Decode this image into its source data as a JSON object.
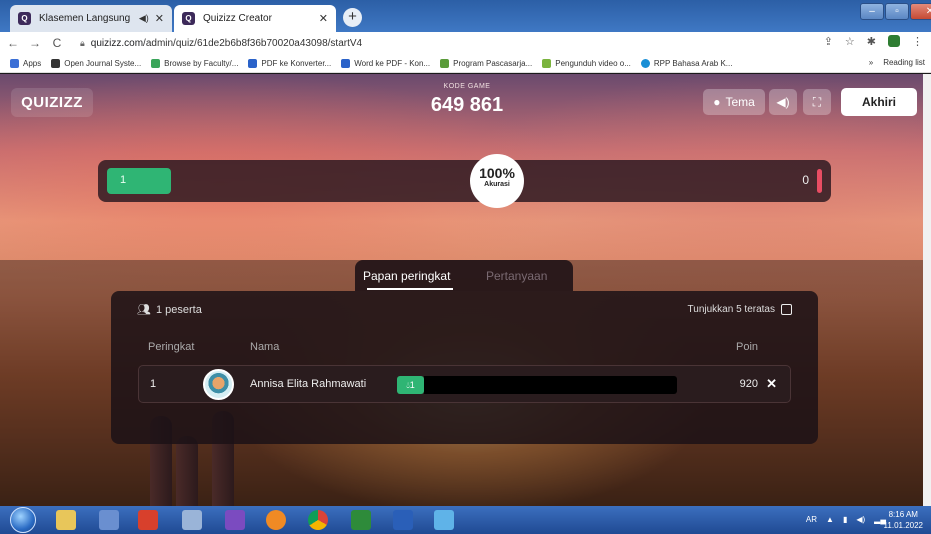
{
  "browser": {
    "tabs": [
      {
        "title": "Klasemen Langsung",
        "audio_icon": "speaker-icon"
      },
      {
        "title": "Quizizz Creator"
      }
    ],
    "url_host": "quizizz.com",
    "url_path": "/admin/quiz/61de2b6b8f36b70020a43098/startV4",
    "bookmarks": [
      "Apps",
      "Open Journal Syste...",
      "Browse by Faculty/...",
      "PDF ke Konverter...",
      "Word ke PDF - Kon...",
      "Program Pascasarja...",
      "Pengunduh video o...",
      "RPP Bahasa Arab K..."
    ],
    "bookmark_chevron": "»",
    "reading_list": "Reading list"
  },
  "quiz": {
    "logo": "QUIZIZZ",
    "code_caption": "KODE GAME",
    "code": "649 861",
    "tema_label": "Tema",
    "end_label": "Akhiri",
    "accuracy": {
      "correct": "1",
      "incorrect": "0",
      "percent": "100%",
      "label": "Akurasi"
    },
    "tabs": [
      "Papan peringkat",
      "Pertanyaan"
    ],
    "participants": "1 peserta",
    "top5_label": "Tunjukkan 5 teratas",
    "columns": {
      "rank": "Peringkat",
      "name": "Nama",
      "points": "Poin"
    },
    "rows": [
      {
        "rank": "1",
        "name": "Annisa Elita Rahmawati",
        "correct": "1",
        "points": "920"
      }
    ]
  },
  "taskbar": {
    "lang": "AR",
    "time": "8:16 AM",
    "date": "11.01.2022"
  }
}
